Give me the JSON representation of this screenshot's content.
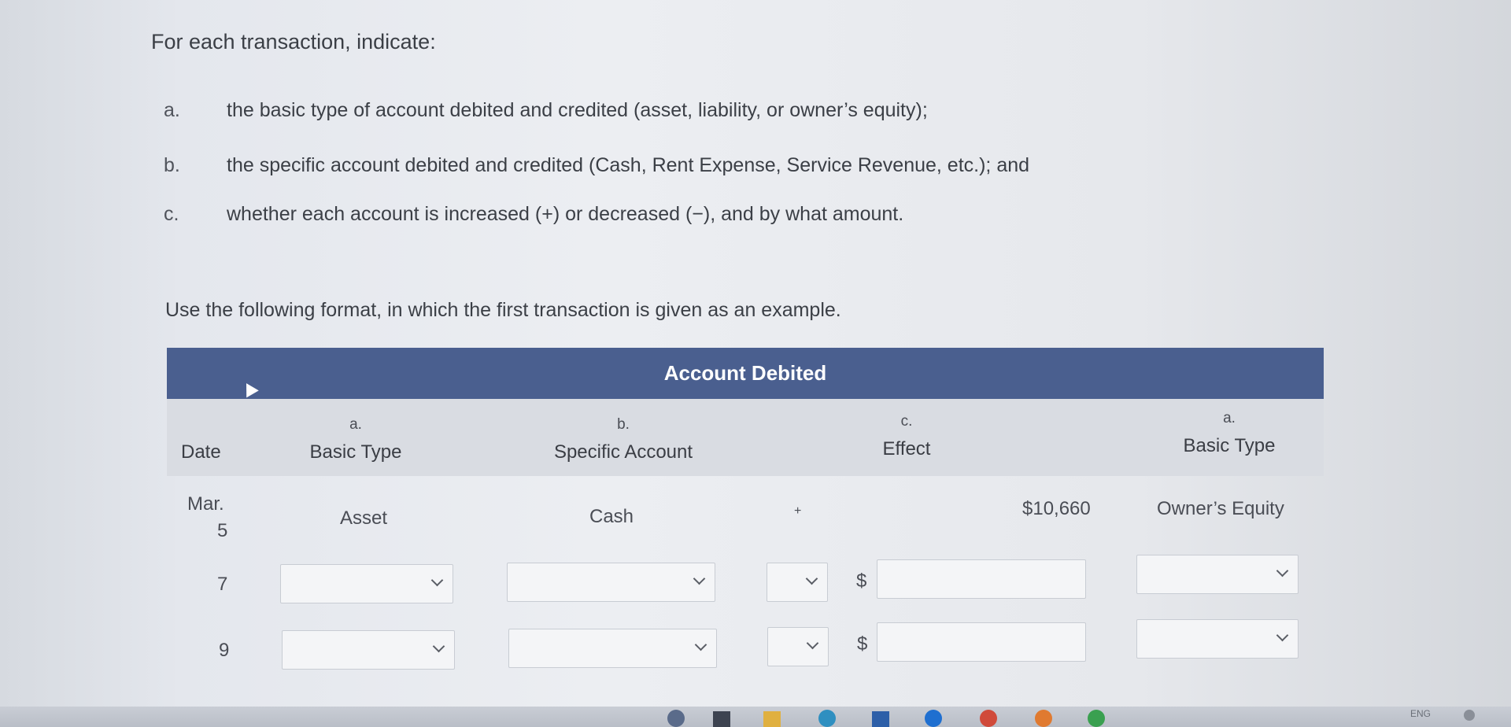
{
  "instructions": {
    "title": "For each transaction, indicate:",
    "items": [
      {
        "letter": "a.",
        "text": "the basic type of account debited and credited (asset, liability, or owner’s equity);"
      },
      {
        "letter": "b.",
        "text": "the specific account debited and credited (Cash, Rent Expense, Service Revenue, etc.); and"
      },
      {
        "letter": "c.",
        "text": "whether each account is increased (+) or decreased (−), and by what amount."
      }
    ],
    "format_note": "Use the following format, in which the first transaction is given as an example."
  },
  "table": {
    "group_header": "Account Debited",
    "columns": {
      "date": "Date",
      "basic_type_letter": "a.",
      "basic_type": "Basic Type",
      "specific_letter": "b.",
      "specific": "Specific Account",
      "effect_letter": "c.",
      "effect": "Effect",
      "credit_type_letter": "a.",
      "credit_type": "Basic Type"
    },
    "example_row": {
      "date_month": "Mar.",
      "date_day": "5",
      "basic_type": "Asset",
      "specific": "Cash",
      "sign": "+",
      "amount": "$10,660",
      "credit_type": "Owner’s Equity"
    },
    "rows": [
      {
        "date": "7",
        "dollar": "$"
      },
      {
        "date": "9",
        "dollar": "$"
      }
    ]
  },
  "taskbar": {
    "tray_lang": "ENG"
  },
  "colors": {
    "header_band": "#4a5f8f",
    "sub_band": "#d9dce2"
  }
}
